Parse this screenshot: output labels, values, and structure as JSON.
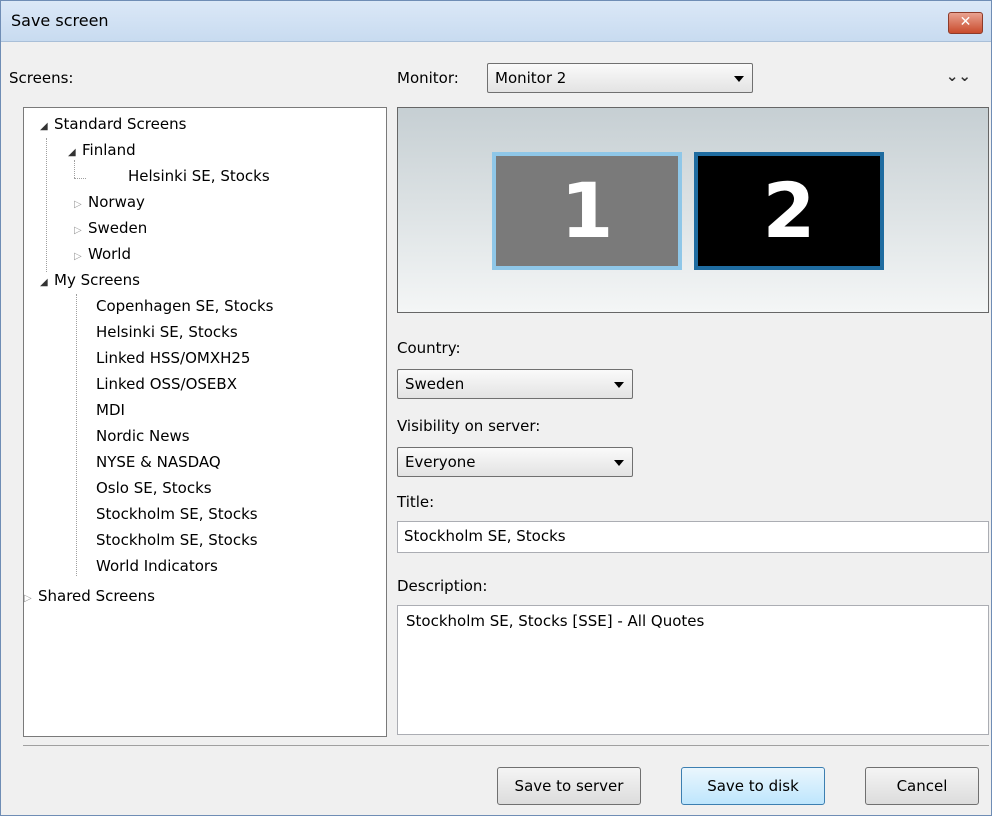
{
  "window": {
    "title": "Save screen",
    "close_label": "✕"
  },
  "screens_label": "Screens:",
  "monitor": {
    "label": "Monitor:",
    "selected": "Monitor 2",
    "expander": "⌄⌄"
  },
  "preview": {
    "monitor1": "1",
    "monitor2": "2"
  },
  "tree": {
    "standard": "Standard Screens",
    "finland": "Finland",
    "finland_child": "Helsinki SE, Stocks",
    "norway": "Norway",
    "sweden": "Sweden",
    "world": "World",
    "my": "My Screens",
    "my_items": [
      "Copenhagen SE, Stocks",
      "Helsinki SE, Stocks",
      "Linked HSS/OMXH25",
      "Linked OSS/OSEBX",
      "MDI",
      "Nordic News",
      "NYSE & NASDAQ",
      "Oslo SE, Stocks",
      "Stockholm SE, Stocks",
      "Stockholm SE, Stocks",
      "World Indicators"
    ],
    "shared": "Shared Screens"
  },
  "country": {
    "label": "Country:",
    "selected": "Sweden"
  },
  "visibility": {
    "label": "Visibility on server:",
    "selected": "Everyone"
  },
  "title_field": {
    "label": "Title:",
    "value": "Stockholm SE, Stocks"
  },
  "description": {
    "label": "Description:",
    "value": "Stockholm SE, Stocks [SSE] - All Quotes"
  },
  "buttons": {
    "save_server": "Save to server",
    "save_disk": "Save to disk",
    "cancel": "Cancel"
  }
}
